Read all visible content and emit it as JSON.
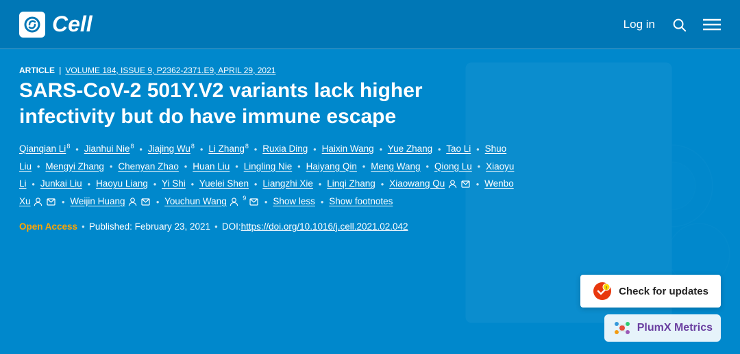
{
  "header": {
    "logo_text": "Cell",
    "nav": {
      "login_label": "Log in",
      "search_icon": "search-icon",
      "menu_icon": "menu-icon"
    }
  },
  "article": {
    "type_label": "ARTICLE",
    "volume_info": "VOLUME 184, ISSUE 9, P2362-2371.E9, APRIL 29, 2021",
    "title": "SARS-CoV-2 501Y.V2 variants lack higher infectivity but do have immune escape",
    "authors_line1": "Qianqian Li",
    "sup1": "8",
    "authors": [
      {
        "name": "Qianqian Li",
        "sup": "8"
      },
      {
        "name": "Jianhui Nie",
        "sup": "8"
      },
      {
        "name": "Jiajing Wu",
        "sup": "8"
      },
      {
        "name": "Li Zhang",
        "sup": "8"
      },
      {
        "name": "Ruxia Ding",
        "sup": ""
      },
      {
        "name": "Haixin Wang",
        "sup": ""
      },
      {
        "name": "Yue Zhang",
        "sup": ""
      },
      {
        "name": "Tao Li",
        "sup": ""
      },
      {
        "name": "Shuo Liu",
        "sup": ""
      },
      {
        "name": "Mengyi Zhang",
        "sup": ""
      },
      {
        "name": "Chenyan Zhao",
        "sup": ""
      },
      {
        "name": "Huan Liu",
        "sup": ""
      },
      {
        "name": "Lingling Nie",
        "sup": ""
      },
      {
        "name": "Haiyang Qin",
        "sup": ""
      },
      {
        "name": "Meng Wang",
        "sup": ""
      },
      {
        "name": "Qiong Lu",
        "sup": ""
      },
      {
        "name": "Xiaoyu Li",
        "sup": ""
      },
      {
        "name": "Junkai Liu",
        "sup": ""
      },
      {
        "name": "Haoyu Liang",
        "sup": ""
      },
      {
        "name": "Yi Shi",
        "sup": ""
      },
      {
        "name": "Yuelei Shen",
        "sup": ""
      },
      {
        "name": "Liangzhi Xie",
        "sup": ""
      },
      {
        "name": "Linqi Zhang",
        "sup": ""
      },
      {
        "name": "Xiaowang Qu",
        "sup": "",
        "has_person": true,
        "has_mail": true
      },
      {
        "name": "Wenbo Xu",
        "sup": "",
        "has_person": true,
        "has_mail": true
      },
      {
        "name": "Weijin Huang",
        "sup": "",
        "has_person": true,
        "has_mail": true
      },
      {
        "name": "Youchun Wang",
        "sup": "9",
        "has_person": true,
        "has_mail": true
      }
    ],
    "show_less_label": "Show less",
    "show_footnotes_label": "Show footnotes",
    "meta": {
      "open_access": "Open Access",
      "published_label": "Published: February 23, 2021",
      "doi_label": "DOI:",
      "doi_url": "https://doi.org/10.1016/j.cell.2021.02.042"
    },
    "check_updates_label": "Check for updates",
    "plumx_label": "PlumX Metrics"
  }
}
